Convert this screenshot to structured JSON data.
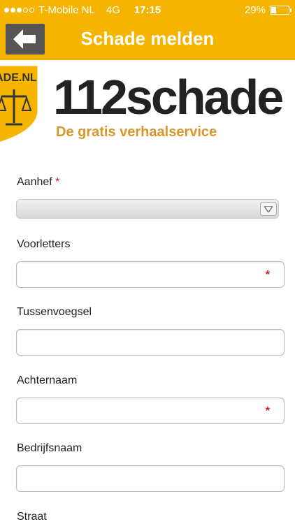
{
  "status_bar": {
    "carrier": "T-Mobile NL",
    "network": "4G",
    "time": "17:15",
    "battery": "29%",
    "battery_level": 0.29,
    "signal_bars_filled": 3,
    "signal_bars_total": 5
  },
  "nav": {
    "title": "Schade melden",
    "back_icon": "arrow-left-icon"
  },
  "banner": {
    "badge_text": "CHADE.NL",
    "brand": "112schade",
    "tagline": "De gratis verhaalservice"
  },
  "form": {
    "aanhef": {
      "label": "Aanhef",
      "required_mark": "*",
      "value": ""
    },
    "voorletters": {
      "label": "Voorletters",
      "required_mark": "*",
      "value": ""
    },
    "tussenvoegsel": {
      "label": "Tussenvoegsel",
      "value": ""
    },
    "achternaam": {
      "label": "Achternaam",
      "required_mark": "*",
      "value": ""
    },
    "bedrijfsnaam": {
      "label": "Bedrijfsnaam",
      "value": ""
    },
    "straat": {
      "label": "Straat"
    }
  },
  "colors": {
    "brand_yellow": "#f5b400",
    "required_red": "#d32020",
    "tagline_orange": "#d9962a"
  }
}
